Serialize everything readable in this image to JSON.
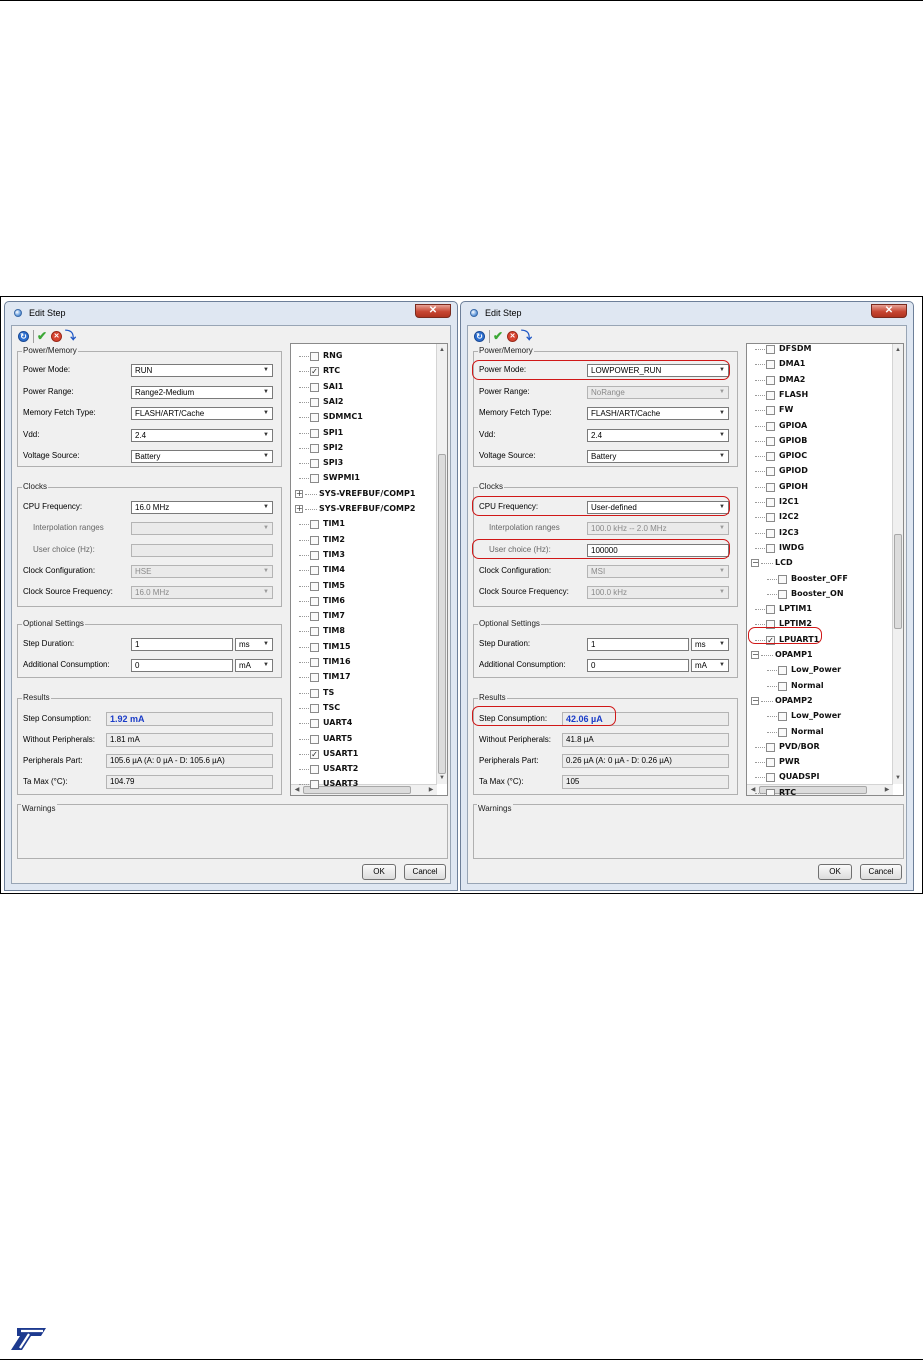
{
  "left": {
    "title": "Edit Step",
    "toolbar": {
      "refresh_icon": "refresh-icon",
      "apply_icon": "check-icon",
      "cancel_icon": "cancel-icon",
      "next_icon": "arrow-next-icon"
    },
    "power": {
      "group": "Power/Memory",
      "mode_label": "Power Mode:",
      "mode": "RUN",
      "range_label": "Power Range:",
      "range": "Range2-Medium",
      "fetch_label": "Memory Fetch Type:",
      "fetch": "FLASH/ART/Cache",
      "vdd_label": "Vdd:",
      "vdd": "2.4",
      "source_label": "Voltage Source:",
      "source": "Battery"
    },
    "clocks": {
      "group": "Clocks",
      "cpu_label": "CPU Frequency:",
      "cpu": "16.0 MHz",
      "interp_label": "Interpolation ranges",
      "interp": "",
      "user_label": "User choice (Hz):",
      "user": "",
      "config_label": "Clock Configuration:",
      "config": "HSE",
      "source_label": "Clock Source Frequency:",
      "source": "16.0 MHz"
    },
    "optional": {
      "group": "Optional Settings",
      "step_label": "Step Duration:",
      "step": "1",
      "step_unit": "ms",
      "add_label": "Additional Consumption:",
      "add": "0",
      "add_unit": "mA"
    },
    "results": {
      "group": "Results",
      "step_label": "Step Consumption:",
      "step": "1.92 mA",
      "without_label": "Without Peripherals:",
      "without": "1.81 mA",
      "periph_label": "Peripherals Part:",
      "periph": "105.6 µA  (A: 0 µA - D: 105.6 µA)",
      "tamax_label": "Ta Max (°C):",
      "tamax": "104.79"
    },
    "tree": [
      {
        "label": "RNG",
        "checked": false
      },
      {
        "label": "RTC",
        "checked": true
      },
      {
        "label": "SAI1",
        "checked": false
      },
      {
        "label": "SAI2",
        "checked": false
      },
      {
        "label": "SDMMC1",
        "checked": false
      },
      {
        "label": "SPI1",
        "checked": false
      },
      {
        "label": "SPI2",
        "checked": false
      },
      {
        "label": "SPI3",
        "checked": false
      },
      {
        "label": "SWPMI1",
        "checked": false
      },
      {
        "label": "SYS-VREFBUF/COMP1",
        "group": true
      },
      {
        "label": "SYS-VREFBUF/COMP2",
        "group": true
      },
      {
        "label": "TIM1",
        "checked": false
      },
      {
        "label": "TIM2",
        "checked": false
      },
      {
        "label": "TIM3",
        "checked": false
      },
      {
        "label": "TIM4",
        "checked": false
      },
      {
        "label": "TIM5",
        "checked": false
      },
      {
        "label": "TIM6",
        "checked": false
      },
      {
        "label": "TIM7",
        "checked": false
      },
      {
        "label": "TIM8",
        "checked": false
      },
      {
        "label": "TIM15",
        "checked": false
      },
      {
        "label": "TIM16",
        "checked": false
      },
      {
        "label": "TIM17",
        "checked": false
      },
      {
        "label": "TS",
        "checked": false
      },
      {
        "label": "TSC",
        "checked": false
      },
      {
        "label": "UART4",
        "checked": false
      },
      {
        "label": "UART5",
        "checked": false
      },
      {
        "label": "USART1",
        "checked": true
      },
      {
        "label": "USART2",
        "checked": false
      },
      {
        "label": "USART3",
        "checked": false
      }
    ],
    "warnings": "Warnings",
    "ok": "OK",
    "cancel": "Cancel"
  },
  "right": {
    "title": "Edit Step",
    "toolbar": {
      "refresh_icon": "refresh-icon",
      "apply_icon": "check-icon",
      "cancel_icon": "cancel-icon",
      "next_icon": "arrow-next-icon"
    },
    "power": {
      "group": "Power/Memory",
      "mode_label": "Power Mode:",
      "mode": "LOWPOWER_RUN",
      "range_label": "Power Range:",
      "range": "NoRange",
      "fetch_label": "Memory Fetch Type:",
      "fetch": "FLASH/ART/Cache",
      "vdd_label": "Vdd:",
      "vdd": "2.4",
      "source_label": "Voltage Source:",
      "source": "Battery"
    },
    "clocks": {
      "group": "Clocks",
      "cpu_label": "CPU Frequency:",
      "cpu": "User-defined",
      "interp_label": "Interpolation ranges",
      "interp": "100.0 kHz -- 2.0 MHz",
      "user_label": "User choice (Hz):",
      "user": "100000",
      "config_label": "Clock Configuration:",
      "config": "MSI",
      "source_label": "Clock Source Frequency:",
      "source": "100.0 kHz"
    },
    "optional": {
      "group": "Optional Settings",
      "step_label": "Step Duration:",
      "step": "1",
      "step_unit": "ms",
      "add_label": "Additional Consumption:",
      "add": "0",
      "add_unit": "mA"
    },
    "results": {
      "group": "Results",
      "step_label": "Step Consumption:",
      "step": "42.06 µA",
      "without_label": "Without Peripherals:",
      "without": "41.8 µA",
      "periph_label": "Peripherals Part:",
      "periph": "0.26 µA  (A: 0 µA - D: 0.26 µA)",
      "tamax_label": "Ta Max (°C):",
      "tamax": "105"
    },
    "tree": [
      {
        "label": "DFSDM",
        "checked": false
      },
      {
        "label": "DMA1",
        "checked": false
      },
      {
        "label": "DMA2",
        "checked": false
      },
      {
        "label": "FLASH",
        "checked": false
      },
      {
        "label": "FW",
        "checked": false
      },
      {
        "label": "GPIOA",
        "checked": false
      },
      {
        "label": "GPIOB",
        "checked": false
      },
      {
        "label": "GPIOC",
        "checked": false
      },
      {
        "label": "GPIOD",
        "checked": false
      },
      {
        "label": "GPIOH",
        "checked": false
      },
      {
        "label": "I2C1",
        "checked": false
      },
      {
        "label": "I2C2",
        "checked": false
      },
      {
        "label": "I2C3",
        "checked": false
      },
      {
        "label": "IWDG",
        "checked": false
      },
      {
        "label": "LCD",
        "group": true
      },
      {
        "label": "Booster_OFF",
        "checked": false,
        "child": true
      },
      {
        "label": "Booster_ON",
        "checked": false,
        "child": true
      },
      {
        "label": "LPTIM1",
        "checked": false
      },
      {
        "label": "LPTIM2",
        "checked": false
      },
      {
        "label": "LPUART1",
        "checked": true
      },
      {
        "label": "OPAMP1",
        "group": true
      },
      {
        "label": "Low_Power",
        "checked": false,
        "child": true
      },
      {
        "label": "Normal",
        "checked": false,
        "child": true
      },
      {
        "label": "OPAMP2",
        "group": true
      },
      {
        "label": "Low_Power",
        "checked": false,
        "child": true
      },
      {
        "label": "Normal",
        "checked": false,
        "child": true
      },
      {
        "label": "PVD/BOR",
        "checked": false
      },
      {
        "label": "PWR",
        "checked": false
      },
      {
        "label": "QUADSPI",
        "checked": false
      },
      {
        "label": "RTC",
        "checked": false
      }
    ],
    "warnings": "Warnings",
    "ok": "OK",
    "cancel": "Cancel"
  },
  "logo_text": "ST",
  "colors": {
    "highlight": "#d01818",
    "result_blue": "#1a3cc8",
    "logo_blue": "#1d3a8f"
  }
}
